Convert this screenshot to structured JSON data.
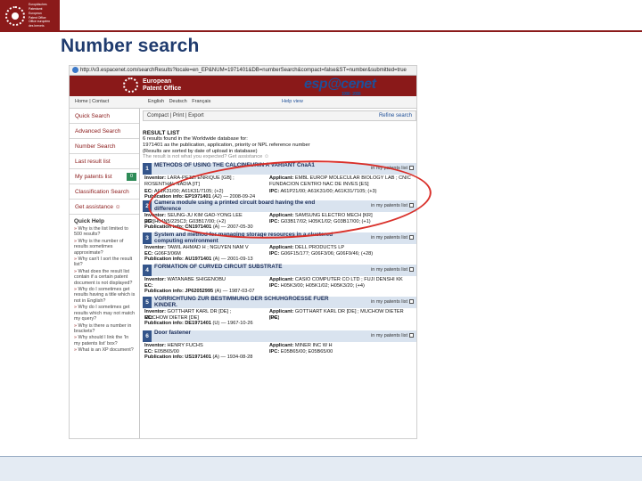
{
  "slide": {
    "title": "Number search",
    "logo_lines": [
      "Europäisches",
      "Patentamt",
      "European",
      "Patent Office",
      "Office européen",
      "des brevets"
    ]
  },
  "browser": {
    "url": "http://v3.espacenet.com/searchResults?locale=en_EP&NUM=1971401&DB=numberSearch&compact=false&ST=number&submitted=true"
  },
  "espacenet": {
    "office_name_1": "European",
    "office_name_2": "Patent Office",
    "brand": "esp@cenet",
    "years": "1998 - 2008",
    "home_contact": "Home | Contact",
    "languages": "English   Deutsch   Français",
    "help_link": "Help view"
  },
  "nav": {
    "items": [
      {
        "label": "Quick Search"
      },
      {
        "label": "Advanced Search"
      },
      {
        "label": "Number Search"
      },
      {
        "label": "Last result list"
      },
      {
        "label": "My patents list",
        "count": "0"
      },
      {
        "label": "Classification Search"
      },
      {
        "label": "Get assistance ☺"
      }
    ],
    "quick_help_title": "Quick Help",
    "quick_help": [
      "Why is the list limited to 500 results?",
      "Why is the number of results sometimes approximate?",
      "Why can't I sort the result list?",
      "What does the result list contain if a certain patent document is not displayed?",
      "Why do I sometimes get results having a title which is not in English?",
      "Why do I sometimes get results which may not match my query?",
      "Why is there a number in brackets?",
      "Why should I link the 'In my patents list' box?",
      "What is an XP document?"
    ]
  },
  "results": {
    "toolbar": {
      "compact": "Compact",
      "print": "Print",
      "export": "Export",
      "refine": "Refine search"
    },
    "heading": "RESULT LIST",
    "lines": [
      "6 results found in the Worldwide database for:",
      "1971401 as the publication, application, priority or NPL reference number",
      "(Results are sorted by date of upload in database)"
    ],
    "note": "The result is not what you expected? Get assistance ☺",
    "in_list_label": "in my patents list",
    "records": [
      {
        "num": "1",
        "title": "METHODS OF USING THE CALCINEURIN A VARIANT CnaA1",
        "inventor": "LARA-PEZZI ENRIQUE [GB] ; ROSENTHAL NADIA [IT]",
        "applicant": "EMBL EUROP MOLECULAR BIOLOGY LAB ; CNIC FUNDACION CENTRO NAC DE INVES [ES]",
        "ec": "A61K31/00; A61K31/7105; (+2)",
        "ipc": "A61P21/00; A61K31/00; A61K31/7105; (+3)",
        "pub": "EP1971401",
        "kind": "(A2)",
        "date": "2008-09-24"
      },
      {
        "num": "2",
        "title": "Camera module using a printed circuit board having the end difference",
        "inventor": "SEUNG-JU KIM GAD-YONG LEE [KR]",
        "applicant": "SAMSUNG ELECTRO MECH [KR]",
        "ec": "H04N5/225C3; G03B17/00; (+2)",
        "ipc": "G03B17/02; H05K1/02; G03B17/00; (+1)",
        "pub": "CN1971401",
        "kind": "(A)",
        "date": "2007-05-30"
      },
      {
        "num": "3",
        "title": "System and method for managing storage resources in a clustered computing environment",
        "inventor": "TAWIL AHMAD H ; NGUYEN NAM V",
        "applicant": "DELL PRODUCTS LP",
        "ec": "G06F3/06M",
        "ipc": "G06F15/177; G06F3/06; G06F9/46; (+28)",
        "pub": "AU1971401",
        "kind": "(A)",
        "date": "2001-09-13"
      },
      {
        "num": "4",
        "title": "FORMATION OF CURVED CIRCUIT SUBSTRATE",
        "inventor": "WATANABE SHIGENOBU",
        "applicant": "CASIO COMPUTER CO LTD ; FUJI DENSHI KK",
        "ec": "",
        "ipc": "H05K3/00; H05K1/02; H05K3/20; (+4)",
        "pub": "JP62052995",
        "kind": "(A)",
        "date": "1987-03-07"
      },
      {
        "num": "5",
        "title": "VORRICHTUNG ZUR BESTIMMUNG DER SCHUHGROESSE FUER KINDER.",
        "inventor": "GOTTHART KARL DR [DE] ; MUCHOW DIETER [DE]",
        "applicant": "GOTTHART KARL DR [DE] ; MUCHOW DIETER [DE]",
        "ec": "",
        "ipc": "",
        "pub": "DE1971401",
        "kind": "(U)",
        "date": "1967-10-26"
      },
      {
        "num": "6",
        "title": "Door fastener",
        "inventor": "HENRY FUCHS",
        "applicant": "MINER INC W H",
        "ec": "E05B65/00",
        "ipc": "E05B65/00; E05B65/00",
        "pub": "US1971401",
        "kind": "(A)",
        "date": "1934-08-28"
      }
    ]
  },
  "labels": {
    "inventor": "Inventor:",
    "applicant": "Applicant:",
    "ec": "EC:",
    "ipc": "IPC:",
    "pub": "Publication info:"
  },
  "colors": {
    "epo_red": "#8a1919",
    "title_blue": "#1f3b6e",
    "highlight_circle": "#d9302a"
  }
}
